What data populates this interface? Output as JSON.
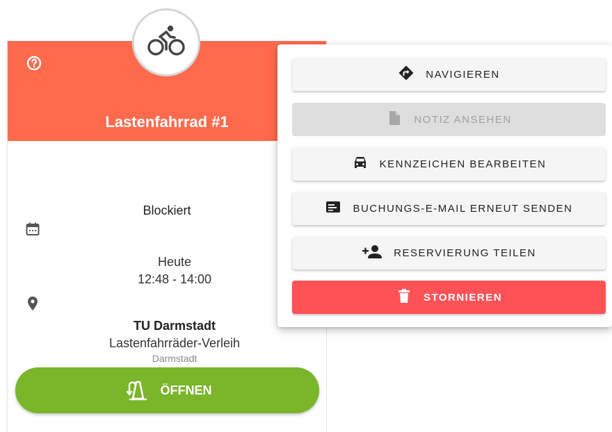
{
  "booking": {
    "vehicle_title": "Lastenfahrrad #1",
    "status": "Blockiert",
    "date_label": "Heute",
    "time_range": "12:48 - 14:00",
    "location_name": "TU Darmstadt",
    "location_sub": "Lastenfahrräder-Verleih",
    "location_city": "Darmstadt",
    "open_label": "ÖFFNEN",
    "header_color": "#ff6a4d",
    "open_color": "#7ab52a"
  },
  "menu": {
    "navigate": "NAVIGIEREN",
    "view_note": "NOTIZ ANSEHEN",
    "edit_plate": "KENNZEICHEN BEARBEITEN",
    "resend_email": "BUCHUNGS-E-MAIL ERNEUT SENDEN",
    "share": "RESERVIERUNG TEILEN",
    "cancel": "STORNIEREN",
    "cancel_color": "#ff5257"
  },
  "icons": {
    "help": "help-circle-icon",
    "bicycle": "bicycle-icon",
    "calendar": "calendar-icon",
    "location": "map-pin-icon",
    "open": "lock-open-icon",
    "navigate": "directions-icon",
    "note": "note-icon",
    "car": "car-icon",
    "email": "card-icon",
    "share": "person-add-icon",
    "delete": "trash-icon"
  }
}
